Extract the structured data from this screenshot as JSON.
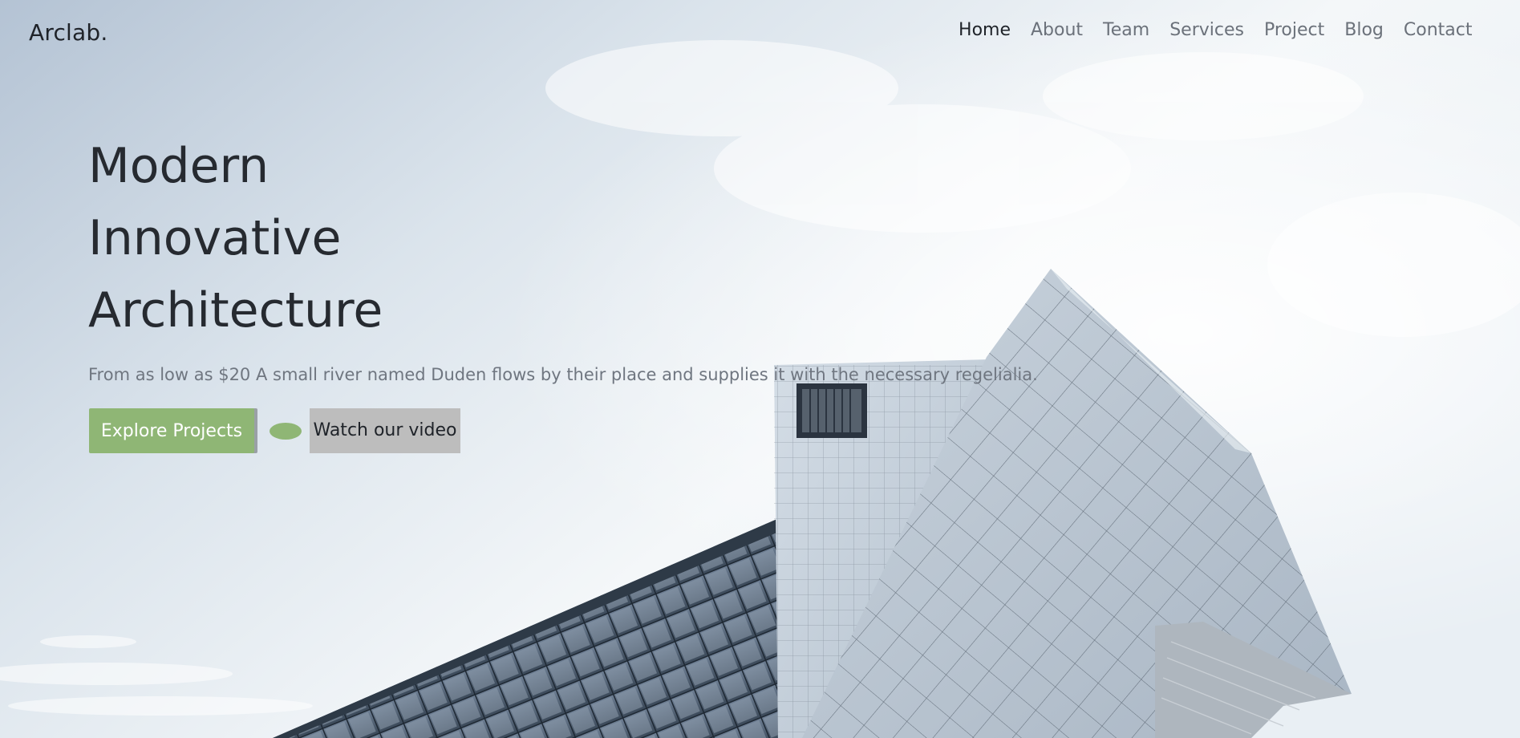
{
  "header": {
    "brand": "Arclab.",
    "nav": [
      {
        "label": "Home",
        "active": true
      },
      {
        "label": "About",
        "active": false
      },
      {
        "label": "Team",
        "active": false
      },
      {
        "label": "Services",
        "active": false
      },
      {
        "label": "Project",
        "active": false
      },
      {
        "label": "Blog",
        "active": false
      },
      {
        "label": "Contact",
        "active": false
      }
    ]
  },
  "hero": {
    "title_lines": [
      "Modern",
      "Innovative",
      "Architecture"
    ],
    "subtitle": "From as low as $20 A small river named Duden flows by their place and supplies it with the necessary regelialia.",
    "primary_button": "Explore Projects",
    "video_button": "Watch our video",
    "play_icon": "play-icon"
  },
  "colors": {
    "accent": "#8fb675",
    "text_dark": "#1f2329",
    "text_muted": "#6b717a",
    "video_button_bg": "#bdbdbd"
  }
}
